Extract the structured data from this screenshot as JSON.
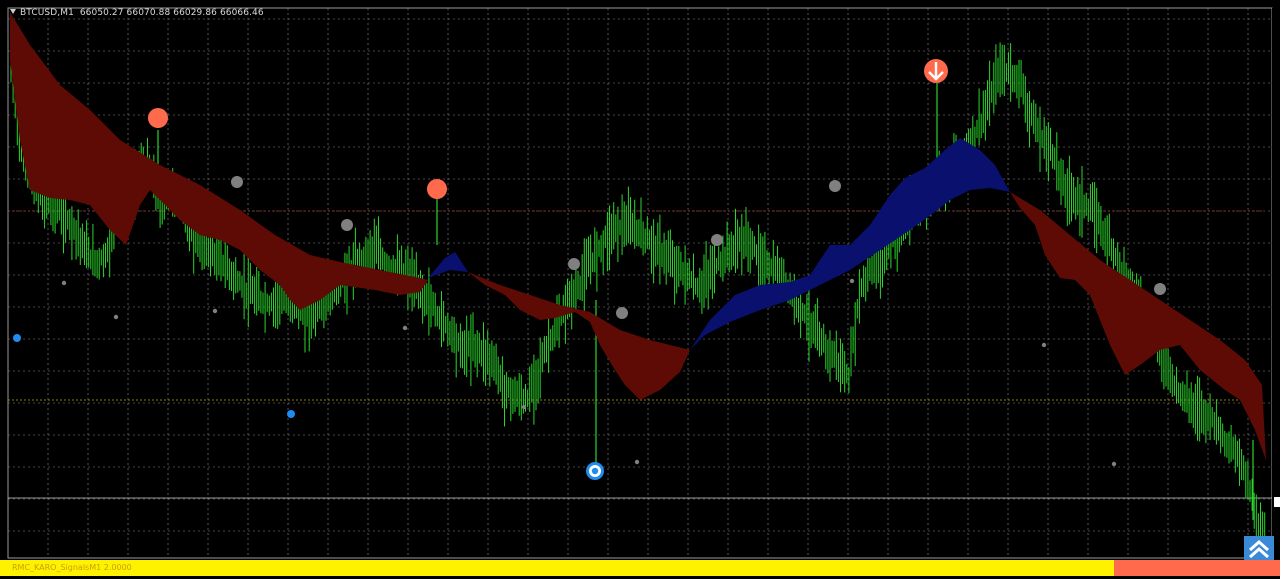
{
  "header": {
    "symbol": "BTCUSD,M1",
    "ohlc": "66050.27 66070.88 66029.86 66066.46"
  },
  "indicator": {
    "label": "RMC_KARO_SignalsM1 2.0000"
  },
  "colors": {
    "background": "#000000",
    "grid": "#8a8a8a",
    "candle": "#2ad62a",
    "cloud_bear": "#5e0b05",
    "cloud_bull": "#0a106e",
    "signal_big": "#ff6a4d",
    "signal_small": "#808080",
    "signal_blue": "#1e8cf0",
    "bar_yellow": "#fff200",
    "bar_red": "#ff6a4d",
    "hline_red": "#b03a2a",
    "hline_yellow": "#c8a000"
  },
  "chart_data": {
    "type": "line",
    "series": [
      {
        "values": [
          62,
          150,
          178,
          200,
          205,
          215,
          228,
          250,
          262,
          255,
          210,
          192,
          175,
          170,
          205,
          190,
          198,
          238,
          245,
          255,
          265,
          280,
          290,
          298,
          305,
          300,
          298,
          310,
          315,
          308,
          296,
          280,
          268,
          260,
          250,
          264,
          272,
          276,
          290,
          302,
          318,
          330,
          350,
          345,
          352,
          362,
          390,
          395,
          402,
          375,
          345,
          325,
          300,
          285,
          262,
          245,
          230,
          225,
          228,
          235,
          248,
          256,
          268,
          275,
          290,
          275,
          262,
          250,
          240,
          245,
          265,
          270,
          278,
          300,
          315,
          335,
          350,
          360,
          380,
          292,
          270,
          265,
          240,
          230,
          210,
          200,
          190,
          180,
          160,
          148,
          128,
          105,
          70,
          72,
          82,
          118,
          140,
          152,
          188,
          196,
          205,
          215,
          238,
          260,
          285,
          305,
          318,
          352,
          378,
          395,
          405,
          412,
          420,
          440,
          455,
          475,
          520,
          528
        ]
      }
    ],
    "icons": [
      "sell-arrow-icon",
      "buy-arrow-icon",
      "ring-signal-icon"
    ]
  }
}
